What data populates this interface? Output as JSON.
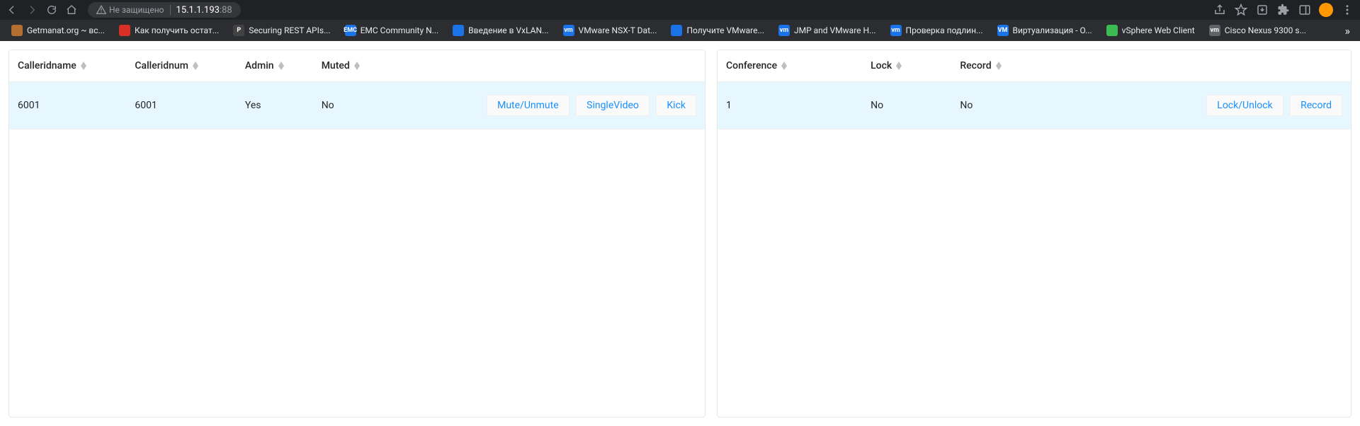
{
  "browser": {
    "security_label": "Не защищено",
    "host": "15.1.1.193",
    "port": ":88"
  },
  "bookmarks": [
    {
      "label": "Getmanat.org ~ вс...",
      "color": "#b36f2f"
    },
    {
      "label": "Как получить остат...",
      "color": "#d93025"
    },
    {
      "label": "Securing REST APIs...",
      "color": "#424242",
      "glyph": "P"
    },
    {
      "label": "EMC Community N...",
      "color": "#1a73e8",
      "glyph": "EMC"
    },
    {
      "label": "Введение в VxLAN...",
      "color": "#1a73e8"
    },
    {
      "label": "VMware NSX-T Dat...",
      "color": "#1a73e8",
      "glyph": "vm"
    },
    {
      "label": "Получите VMware...",
      "color": "#1a73e8"
    },
    {
      "label": "JMP and VMware H...",
      "color": "#1a73e8",
      "glyph": "vm"
    },
    {
      "label": "Проверка подлин...",
      "color": "#1a73e8",
      "glyph": "vm"
    },
    {
      "label": "Виртуализация - О...",
      "color": "#1a73e8",
      "glyph": "VM"
    },
    {
      "label": "vSphere Web Client",
      "color": "#3cba54"
    },
    {
      "label": "Cisco Nexus 9300 s...",
      "color": "#5f6368",
      "glyph": "vm"
    }
  ],
  "participants": {
    "headers": {
      "calleridname": "Calleridname",
      "calleridnum": "Calleridnum",
      "admin": "Admin",
      "muted": "Muted"
    },
    "rows": [
      {
        "calleridname": "6001",
        "calleridnum": "6001",
        "admin": "Yes",
        "muted": "No"
      }
    ],
    "actions": {
      "mute": "Mute/Unmute",
      "single": "SingleVideo",
      "kick": "Kick"
    }
  },
  "conferences": {
    "headers": {
      "conference": "Conference",
      "lock": "Lock",
      "record": "Record"
    },
    "rows": [
      {
        "conference": "1",
        "lock": "No",
        "record": "No"
      }
    ],
    "actions": {
      "lock": "Lock/Unlock",
      "record": "Record"
    }
  }
}
